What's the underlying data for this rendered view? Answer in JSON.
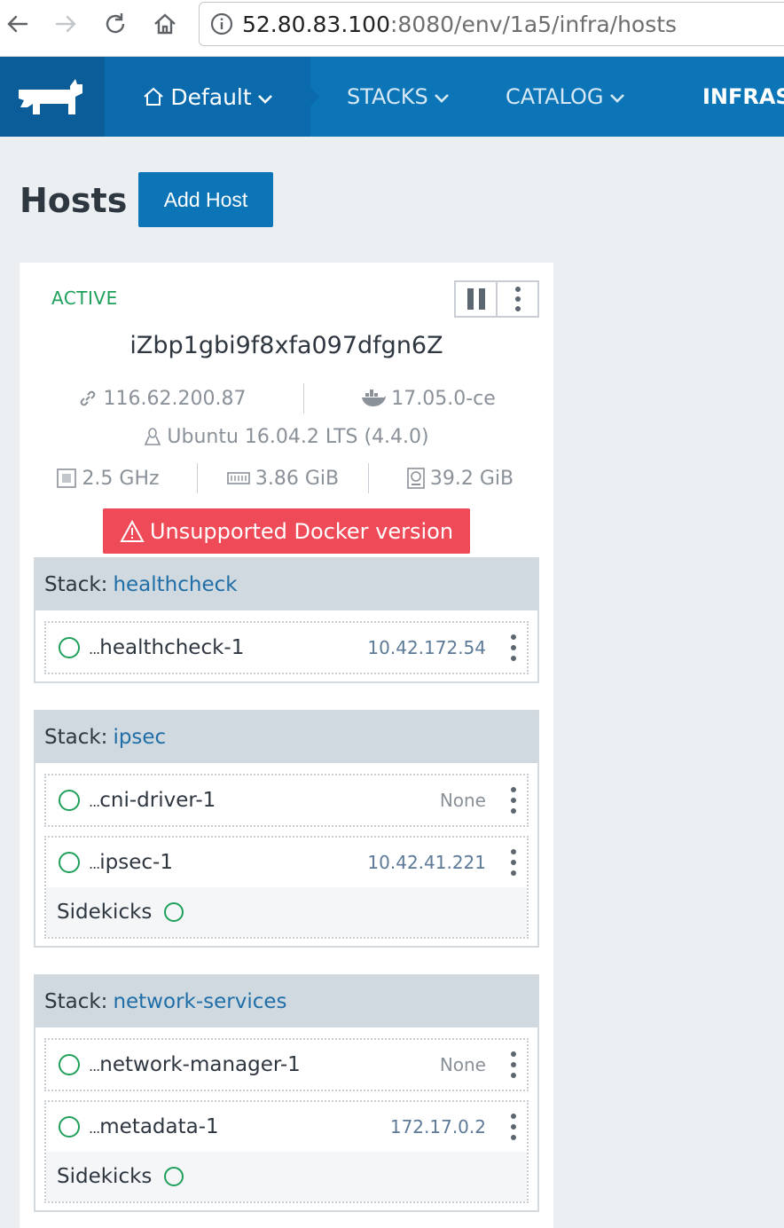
{
  "browser": {
    "url_host": "52.80.83.100",
    "url_rest": ":8080/env/1a5/infra/hosts",
    "icons": [
      "back-arrow-icon",
      "forward-arrow-icon",
      "reload-icon",
      "home-icon",
      "info-icon"
    ]
  },
  "header": {
    "environment": "Default",
    "nav": [
      "STACKS",
      "CATALOG",
      "INFRAS"
    ]
  },
  "page": {
    "title": "Hosts",
    "add_host_label": "Add Host"
  },
  "host": {
    "state": "ACTIVE",
    "name": "iZbp1gbi9f8xfa097dfgn6Z",
    "ip": "116.62.200.87",
    "docker_version": "17.05.0-ce",
    "os": "Ubuntu 16.04.2 LTS (4.4.0)",
    "cpu": "2.5 GHz",
    "memory": "3.86 GiB",
    "storage": "39.2 GiB",
    "warning": "Unsupported Docker version"
  },
  "stacks": [
    {
      "prefix": "Stack:",
      "name": "healthcheck",
      "containers": [
        {
          "dots": "...",
          "name": "healthcheck-1",
          "ip": "10.42.172.54"
        }
      ]
    },
    {
      "prefix": "Stack:",
      "name": "ipsec",
      "containers": [
        {
          "dots": "...",
          "name": "cni-driver-1",
          "ip": "None"
        },
        {
          "dots": "...",
          "name": "ipsec-1",
          "ip": "10.42.41.221",
          "sidekicks": "Sidekicks"
        }
      ]
    },
    {
      "prefix": "Stack:",
      "name": "network-services",
      "containers": [
        {
          "dots": "...",
          "name": "network-manager-1",
          "ip": "None"
        },
        {
          "dots": "...",
          "name": "metadata-1",
          "ip": "172.17.0.2",
          "sidekicks": "Sidekicks"
        }
      ]
    }
  ],
  "colors": {
    "header_blue": "#0b75b7",
    "active_green": "#1fa05a",
    "warning_red": "#ef4a57",
    "link_blue": "#1f6ea8"
  }
}
